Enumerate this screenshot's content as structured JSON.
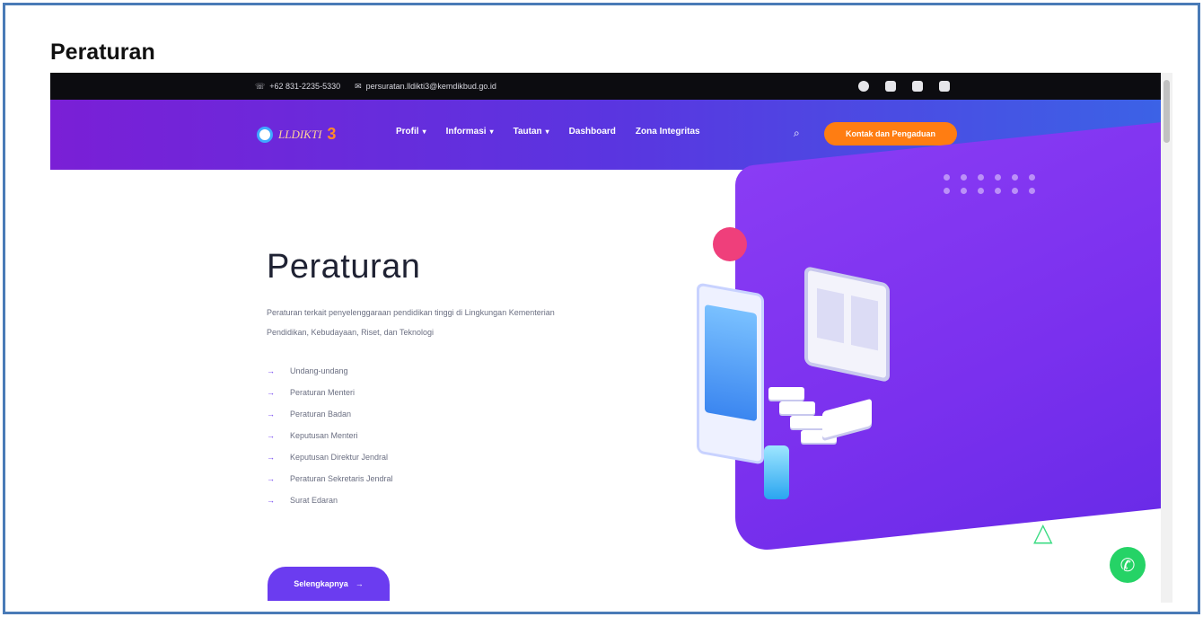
{
  "document": {
    "title": "Peraturan"
  },
  "topbar": {
    "phone": "+62 831-2235-5330",
    "email": "persuratan.lldikti3@kemdikbud.go.id",
    "social_icons": [
      "facebook-icon",
      "instagram-icon",
      "square-social-icon",
      "youtube-icon"
    ]
  },
  "navbar": {
    "logo_text": "LLDIKTI",
    "logo_number": "3",
    "menu": [
      {
        "label": "Profil",
        "dropdown": true
      },
      {
        "label": "Informasi",
        "dropdown": true
      },
      {
        "label": "Tautan",
        "dropdown": true
      },
      {
        "label": "Dashboard",
        "dropdown": false
      },
      {
        "label": "Zona Integritas",
        "dropdown": false
      }
    ],
    "search_icon": "search-icon",
    "cta_label": "Kontak dan Pengaduan"
  },
  "hero": {
    "heading": "Peraturan",
    "description": "Peraturan terkait penyelenggaraan pendidikan tinggi di Lingkungan Kementerian Pendidikan, Kebudayaan, Riset, dan Teknologi",
    "list": [
      "Undang-undang",
      "Peraturan Menteri",
      "Peraturan Badan",
      "Keputusan Menteri",
      "Keputusan Direktur Jendral",
      "Peraturan Sekretaris Jendral",
      "Surat Edaran"
    ],
    "more_label": "Selengkapnya",
    "arrow_glyph": "→"
  },
  "colors": {
    "accent": "#6b3cf0",
    "cta": "#ff7d12",
    "whatsapp": "#25d366"
  }
}
